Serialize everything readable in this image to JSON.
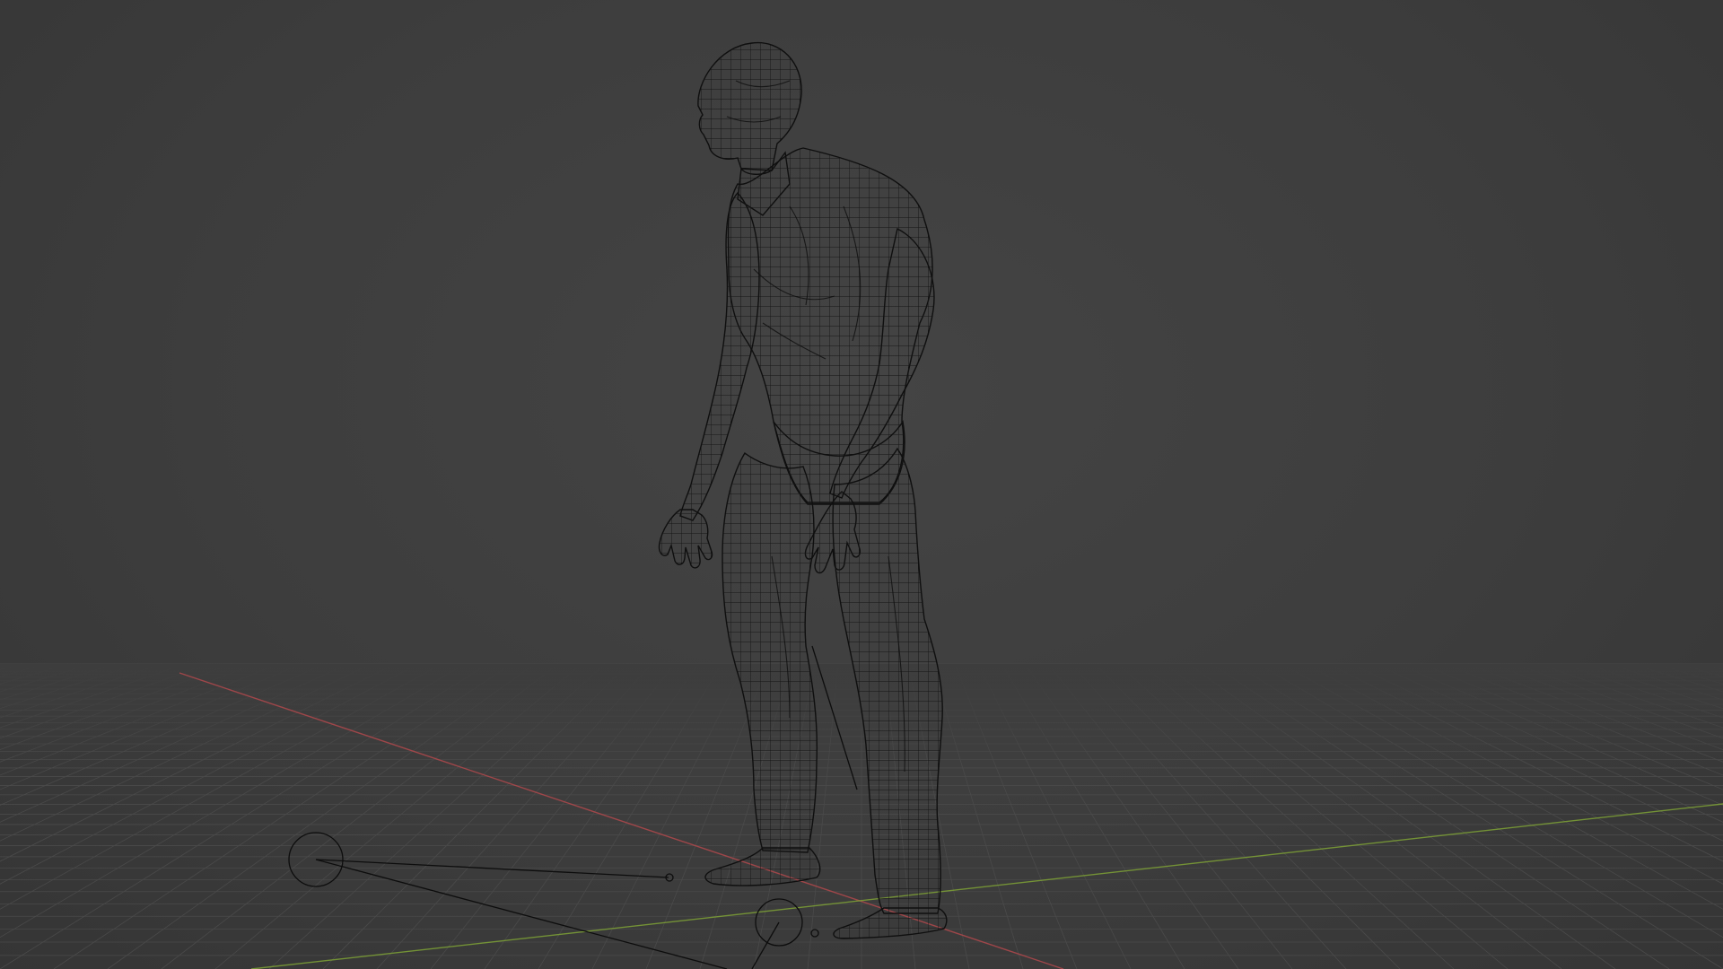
{
  "viewport": {
    "mode": "wireframe",
    "background_color": "#3d3d3d",
    "grid_color": "#4a4a4a",
    "x_axis_color": "#b0484c",
    "y_axis_color": "#7ea236",
    "wire_color": "#111111"
  },
  "scene": {
    "objects": [
      {
        "name": "human-body-mesh",
        "type": "mesh"
      },
      {
        "name": "ik-control-left-foot",
        "type": "empty-circle"
      },
      {
        "name": "ik-control-right-foot",
        "type": "empty-circle"
      },
      {
        "name": "pole-target",
        "type": "empty-circle"
      }
    ]
  }
}
